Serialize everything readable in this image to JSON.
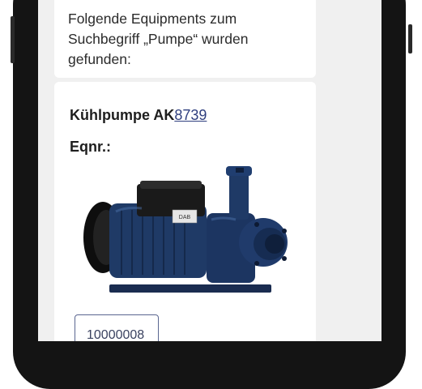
{
  "search_result": {
    "message": "Folgende Equipments zum Suchbegriff „Pumpe“ wurden gefunden:"
  },
  "equipment": {
    "title_prefix": "Kühlpumpe AK",
    "title_link": "8739",
    "eqnr_label": "Eqnr.:",
    "image_label": "DAB",
    "id_button_label": "10000008"
  },
  "colors": {
    "screen_bg": "#f0f0f0",
    "card_bg": "#ffffff",
    "link": "#2f3f7f",
    "pump_blue": "#1f3a66"
  }
}
